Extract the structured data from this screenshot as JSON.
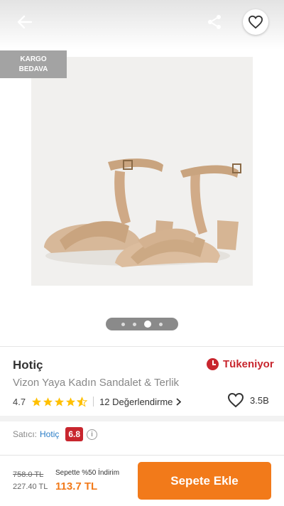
{
  "header": {
    "back_icon": "back-arrow-icon",
    "share_icon": "share-icon",
    "favorite_icon": "heart-icon"
  },
  "gallery": {
    "badge_line1": "KARGO",
    "badge_line2": "BEDAVA",
    "image_count": 4,
    "active_index": 2
  },
  "product": {
    "brand": "Hotiç",
    "stock_status": "Tükeniyor",
    "title": "Vizon Yaya Kadın Sandalet & Terlik",
    "rating": "4.7",
    "rating_value": 4.7,
    "reviews": "12 Değerlendirme",
    "likes": "3.5B"
  },
  "seller": {
    "label": "Satıcı:",
    "name": "Hotiç",
    "score": "6.8"
  },
  "pricing": {
    "old_price": "758.0 TL",
    "cart_price": "227.40 TL",
    "discount_label": "Sepette %50 İndirim",
    "final_price": "113.7 TL",
    "button_label": "Sepete Ekle"
  },
  "colors": {
    "accent": "#f27a1a",
    "danger": "#c8262e",
    "star": "#ffc000",
    "link": "#2a7dc7"
  }
}
